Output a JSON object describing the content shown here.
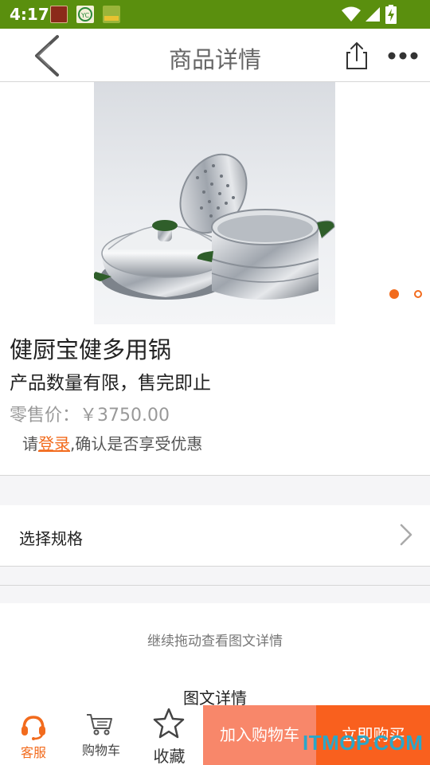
{
  "status_bar": {
    "time": "4:17",
    "bg_color": "#5a8f0e",
    "notification_icons": [
      "app-notification-icon",
      "yc-app-icon",
      "game-app-icon"
    ],
    "indicators": [
      "wifi-icon",
      "signal-icon",
      "battery-charging-icon"
    ]
  },
  "header": {
    "title": "商品详情",
    "back_icon": "back-chevron-icon",
    "share_icon": "share-icon",
    "more_icon": "more-dots-icon"
  },
  "product": {
    "carousel_pages": 2,
    "carousel_active_index": 0,
    "name": "健厨宝健多用锅",
    "limit_note": "产品数量有限，售完即止",
    "price_label": "零售价：",
    "price_value": "￥3750.00",
    "login_prefix": "请",
    "login_link": "登录",
    "login_suffix": ",确认是否享受优惠"
  },
  "spec": {
    "label": "选择规格",
    "chevron_icon": "chevron-right-icon"
  },
  "detail": {
    "drag_hint": "继续拖动查看图文详情",
    "tab_label": "图文详情"
  },
  "bottom_bar": {
    "service_label": "客服",
    "cart_label": "购物车",
    "favorite_label": "收藏",
    "add_to_cart_label": "加入购物车",
    "buy_now_label": "立即购买",
    "accent_color": "#f26b1d"
  },
  "watermark": "ITMOP.COM"
}
